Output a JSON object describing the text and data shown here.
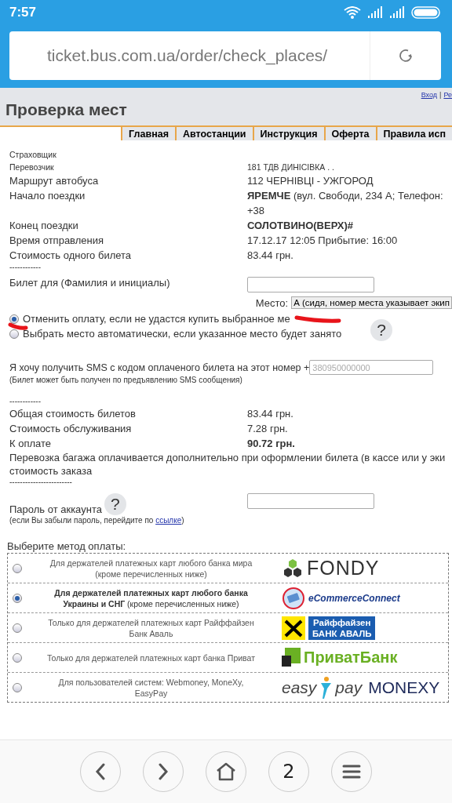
{
  "status_bar": {
    "time": "7:57"
  },
  "address_bar": {
    "url": "ticket.bus.com.ua/order/check_places/"
  },
  "header": {
    "links": [
      "Вход",
      "Ре"
    ],
    "link_divider": "|",
    "title": "Проверка мест"
  },
  "menu_tabs": [
    "Главная",
    "Автостанции",
    "Инструкция",
    "Оферта",
    "Правила исп"
  ],
  "trip_info": [
    {
      "label": "Страховщик",
      "kind": "small"
    },
    {
      "label": "Перевозчик",
      "value": "181 ТДВ ДИНІСІВКА . .",
      "kind": "small"
    },
    {
      "label": "Маршрут автобуса",
      "value": "112 ЧЕРНІВЦІ - УЖГОРОД",
      "kind": "normal"
    },
    {
      "label": "Начало поездки",
      "value": "**ЯРЕМЧЕ** (вул. Свободи, 234 А; Телефон: +38",
      "kind": "normal"
    },
    {
      "label": "Конец поездки",
      "value": "СОЛОТВИНО(ВЕРХ)#",
      "kind": "normal",
      "emphasis": true
    },
    {
      "label": "Время отправления",
      "value": "17.12.17 12:05  Прибытие: 16:00",
      "kind": "normal"
    },
    {
      "label": "Стоимость одного билета",
      "value": "83.44 грн.",
      "kind": "normal"
    }
  ],
  "separator_1": "------------",
  "passenger": {
    "label": "Билет для (Фамилия и инициалы)",
    "seat_label": "Место:",
    "seat_value": "А (сидя, номер места указывает экип"
  },
  "seat_options": [
    {
      "label": "Отменить оплату, если не удастся купить выбранное ме",
      "selected": true
    },
    {
      "label": "Выбрать место автоматически, если указанное место будет занято",
      "selected": false
    }
  ],
  "help_mark": "?",
  "sms": {
    "label": "Я хочу получить SMS с кодом оплаченого билета на этот номер +",
    "placeholder": "380950000000",
    "note": "(Билет может быть получен по предъявлению SMS сообщения)"
  },
  "separator_2": "------------",
  "totals": [
    {
      "label": "Общая стоимость билетов",
      "value": "83.44 грн.",
      "emphasis": false
    },
    {
      "label": "Стоимость обслуживания",
      "value": "7.28 грн.",
      "emphasis": false
    },
    {
      "label": "К оплате",
      "value": "90.72 грн.",
      "emphasis": true
    }
  ],
  "baggage_note": [
    "Перевозка багажа оплачивается дополнительно при оформлении билета (в кассе или у эки",
    "стоимость заказа"
  ],
  "separator_3": "------------------------",
  "password": {
    "label": "Пароль от аккаунта",
    "help_mark": "?",
    "note": "(если Вы забыли пароль, перейдите по ",
    "link": "ссылке",
    "note_end": ")"
  },
  "payment": {
    "title": "Выберите метод оплаты:",
    "methods": [
      {
        "description": "Для держателей платежных карт любого банка мира (кроме перечисленных ниже)",
        "selected": false,
        "logo": {
          "kind": "fondy",
          "texts": [
            "FONDY"
          ]
        }
      },
      {
        "description": "**Для держателей платежных карт любого банка Украины и СНГ** (кроме перечисленных ниже)",
        "selected": true,
        "logo": {
          "kind": "ecommerce",
          "texts": [
            "eCommerceConnect"
          ]
        }
      },
      {
        "description": "Только для держателей платежных карт Райффайзен Банк Аваль",
        "selected": false,
        "logo": {
          "kind": "raiffeisen",
          "texts": [
            "Райффайзен",
            "БАНК АВАЛЬ"
          ]
        }
      },
      {
        "description": "Только для держателей платежных карт банка Приват",
        "selected": false,
        "logo": {
          "kind": "privat",
          "texts": [
            "ПриватБанк"
          ]
        }
      },
      {
        "description": "Для пользователей систем: Webmoney, MoneXy, EasyPay",
        "selected": false,
        "logo": {
          "kind": "easypay",
          "texts": [
            "easy",
            "pay",
            "MONEXY"
          ]
        }
      }
    ]
  },
  "bottom_nav": [
    {
      "kind": "back"
    },
    {
      "kind": "forward"
    },
    {
      "kind": "home"
    },
    {
      "kind": "tabs",
      "label": "2"
    },
    {
      "kind": "menu"
    }
  ]
}
